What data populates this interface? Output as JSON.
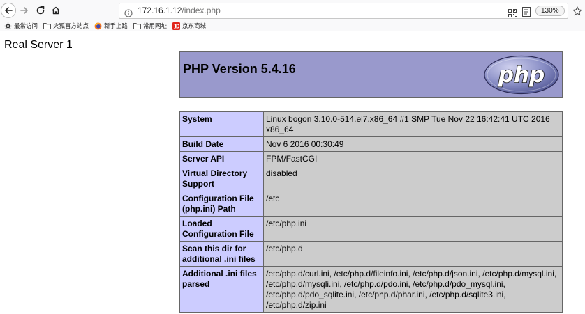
{
  "browser": {
    "url": {
      "host": "172.16.1.12",
      "path": "/index.php"
    },
    "zoom": "130%",
    "icons": {
      "back": "back-arrow-icon",
      "forward": "forward-arrow-icon",
      "reload": "reload-icon",
      "home": "home-icon",
      "site_info": "info-icon",
      "qr": "qr-code-icon",
      "reader": "reader-view-icon",
      "bookmark": "bookmark-star-icon"
    },
    "bookmarks": [
      {
        "label": "最常访问",
        "icon": "gear-icon"
      },
      {
        "label": "火狐官方站点",
        "icon": "folder-icon"
      },
      {
        "label": "新手上路",
        "icon": "firefox-icon"
      },
      {
        "label": "常用网址",
        "icon": "folder-icon"
      },
      {
        "label": "京东商城",
        "icon": "jd-logo-icon"
      }
    ]
  },
  "page": {
    "heading": "Real Server 1",
    "php_version_title": "PHP Version 5.4.16",
    "logo_text": "php",
    "colors": {
      "header_bg": "#9999cc",
      "key_bg": "#ccccff",
      "value_bg": "#cccccc"
    },
    "info_rows": [
      {
        "key": "System",
        "value": "Linux bogon 3.10.0-514.el7.x86_64 #1 SMP Tue Nov 22 16:42:41 UTC 2016 x86_64"
      },
      {
        "key": "Build Date",
        "value": "Nov 6 2016 00:30:49"
      },
      {
        "key": "Server API",
        "value": "FPM/FastCGI"
      },
      {
        "key": "Virtual Directory Support",
        "value": "disabled"
      },
      {
        "key": "Configuration File (php.ini) Path",
        "value": "/etc"
      },
      {
        "key": "Loaded Configuration File",
        "value": "/etc/php.ini"
      },
      {
        "key": "Scan this dir for additional .ini files",
        "value": "/etc/php.d"
      },
      {
        "key": "Additional .ini files parsed",
        "value": "/etc/php.d/curl.ini, /etc/php.d/fileinfo.ini, /etc/php.d/json.ini, /etc/php.d/mysql.ini, /etc/php.d/mysqli.ini, /etc/php.d/pdo.ini, /etc/php.d/pdo_mysql.ini, /etc/php.d/pdo_sqlite.ini, /etc/php.d/phar.ini, /etc/php.d/sqlite3.ini, /etc/php.d/zip.ini"
      }
    ]
  }
}
